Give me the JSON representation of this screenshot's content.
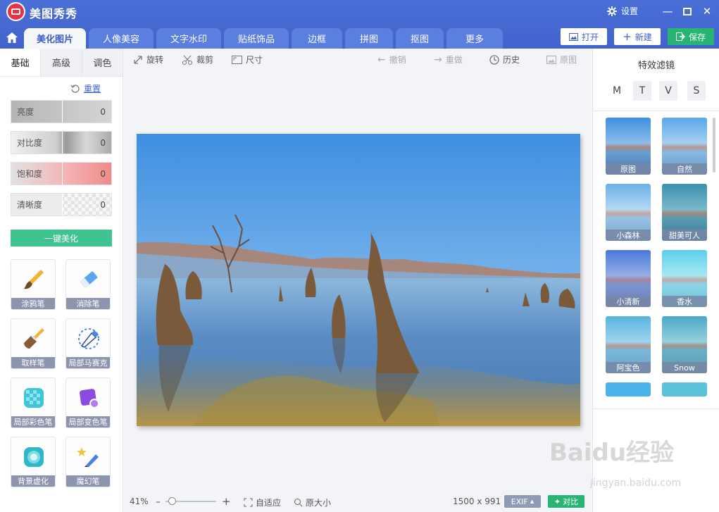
{
  "app": {
    "title": "美图秀秀",
    "settings_label": "设置"
  },
  "nav_tabs": [
    {
      "label": "美化图片",
      "active": true
    },
    {
      "label": "人像美容"
    },
    {
      "label": "文字水印"
    },
    {
      "label": "贴纸饰品"
    },
    {
      "label": "边框"
    },
    {
      "label": "拼图"
    },
    {
      "label": "抠图"
    },
    {
      "label": "更多"
    }
  ],
  "top_buttons": {
    "open": "打开",
    "new": "新建",
    "save": "保存"
  },
  "left_tabs": [
    {
      "label": "基础",
      "active": true
    },
    {
      "label": "高级"
    },
    {
      "label": "调色"
    }
  ],
  "reset_label": "重置",
  "adjustments": [
    {
      "label": "亮度",
      "value": "0"
    },
    {
      "label": "对比度",
      "value": "0"
    },
    {
      "label": "饱和度",
      "value": "0"
    },
    {
      "label": "清晰度",
      "value": "0"
    }
  ],
  "auto_beautify": "一键美化",
  "tools": [
    {
      "label": "涂鸦笔",
      "icon": "paintbrush-icon"
    },
    {
      "label": "消除笔",
      "icon": "eraser-icon"
    },
    {
      "label": "取样笔",
      "icon": "sampling-brush-icon"
    },
    {
      "label": "局部马赛克",
      "icon": "mosaic-pen-icon"
    },
    {
      "label": "局部彩色笔",
      "icon": "color-pen-icon"
    },
    {
      "label": "局部变色笔",
      "icon": "recolor-pen-icon"
    },
    {
      "label": "背景虚化",
      "icon": "blur-background-icon"
    },
    {
      "label": "魔幻笔",
      "icon": "magic-pen-icon"
    }
  ],
  "toolbar": {
    "rotate": "旋转",
    "crop": "裁剪",
    "size": "尺寸",
    "undo": "撤销",
    "redo": "重做",
    "history": "历史",
    "original": "原图"
  },
  "effects": {
    "title": "特效滤镜",
    "categories": [
      {
        "label": "M",
        "active": true
      },
      {
        "label": "T"
      },
      {
        "label": "V"
      },
      {
        "label": "S"
      }
    ],
    "items": [
      {
        "label": "原图"
      },
      {
        "label": "自然"
      },
      {
        "label": "小森林"
      },
      {
        "label": "甜美可人"
      },
      {
        "label": "小清新"
      },
      {
        "label": "香水"
      },
      {
        "label": "阿宝色"
      },
      {
        "label": "Snow"
      },
      {
        "label": ""
      },
      {
        "label": ""
      }
    ]
  },
  "status": {
    "zoom": "41%",
    "zoom_fraction": 0.41,
    "fit": "自适应",
    "actual_size": "原大小",
    "dimensions": "1500 x 991",
    "exif": "EXIF",
    "compare": "对比"
  },
  "watermark": {
    "brand": "Baidu经验",
    "url": "jingyan.baidu.com"
  },
  "colors": {
    "title_bar": "#4262cc",
    "accent_green": "#28b574",
    "tab_blue": "#5b7fe0"
  }
}
